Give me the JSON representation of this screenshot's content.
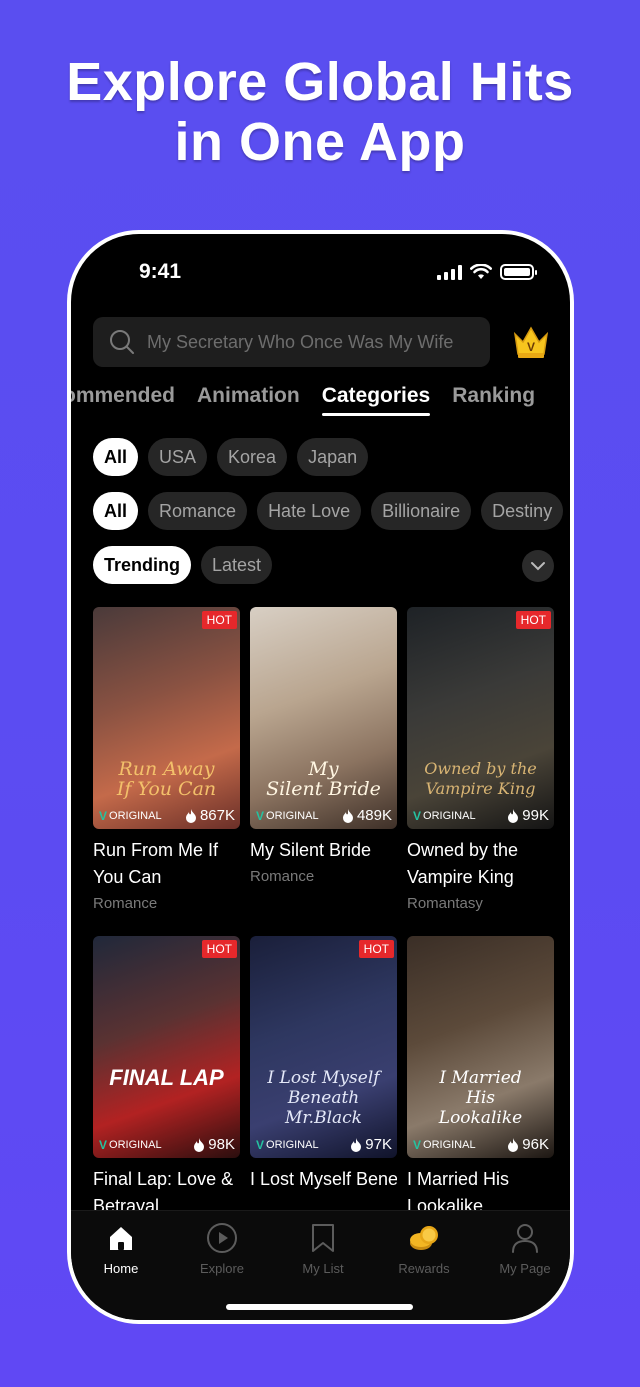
{
  "headline": {
    "line1": "Explore Global Hits",
    "line2": "in One App"
  },
  "status": {
    "time": "9:41"
  },
  "search": {
    "placeholder": "My Secretary Who Once Was My Wife"
  },
  "tabs": [
    {
      "label": "ommended"
    },
    {
      "label": "Animation"
    },
    {
      "label": "Categories"
    },
    {
      "label": "Ranking"
    }
  ],
  "regions": [
    "All",
    "USA",
    "Korea",
    "Japan"
  ],
  "genres": [
    "All",
    "Romance",
    "Hate Love",
    "Billionaire",
    "Destiny"
  ],
  "sorts": [
    "Trending",
    "Latest"
  ],
  "cards": [
    {
      "title": "Run From Me If You Can",
      "genre": "Romance",
      "views": "867K",
      "hot": "HOT",
      "original": "ORIGINAL",
      "art": "Run Away\nIf You Can"
    },
    {
      "title": "My Silent Bride",
      "genre": "Romance",
      "views": "489K",
      "hot": "",
      "original": "ORIGINAL",
      "art": "My\nSilent Bride"
    },
    {
      "title": "Owned by the Vampire King",
      "genre": "Romantasy",
      "views": "99K",
      "hot": "HOT",
      "original": "ORIGINAL",
      "art": "Owned by the\nVampire King"
    },
    {
      "title": "Final Lap: Love & Betrayal",
      "genre": "",
      "views": "98K",
      "hot": "HOT",
      "original": "ORIGINAL",
      "art": "FINAL LAP"
    },
    {
      "title": "I Lost Myself Beneath Mr.Bla...",
      "genre": "",
      "views": "97K",
      "hot": "HOT",
      "original": "ORIGINAL",
      "art": "I Lost Myself\nBeneath\nMr.Black"
    },
    {
      "title": "I Married His Lookalike",
      "genre": "",
      "views": "96K",
      "hot": "",
      "original": "ORIGINAL",
      "art": "I Married\nHis\nLookalike"
    }
  ],
  "nav": [
    {
      "label": "Home",
      "icon": "home-icon"
    },
    {
      "label": "Explore",
      "icon": "play-circle-icon"
    },
    {
      "label": "My List",
      "icon": "bookmark-icon"
    },
    {
      "label": "Rewards",
      "icon": "coins-icon"
    },
    {
      "label": "My Page",
      "icon": "user-icon"
    }
  ],
  "colors": {
    "background": "#5b4cf2",
    "hot": "#e6282b",
    "original": "#25c2a0"
  }
}
